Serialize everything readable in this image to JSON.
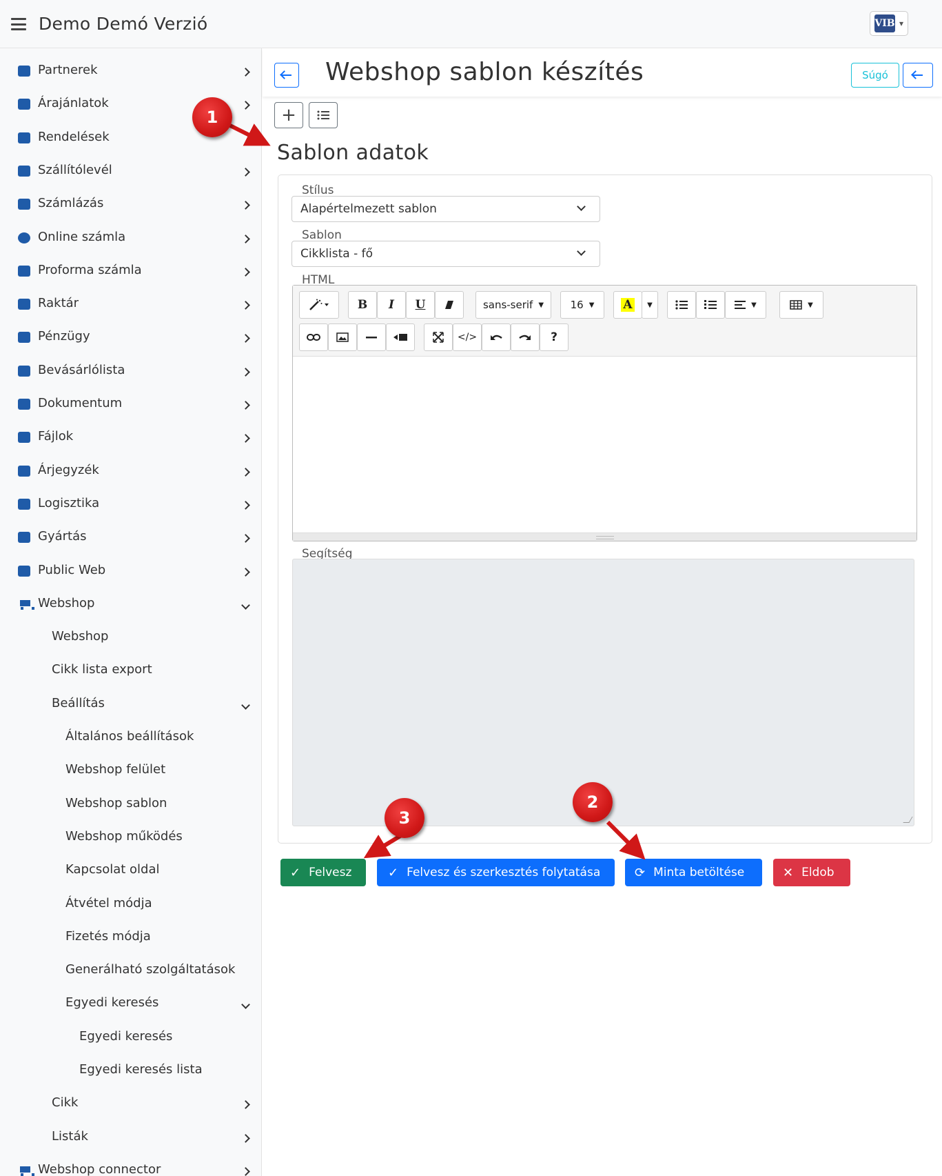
{
  "app": {
    "title": "Demo Demó Verzió",
    "logo_text": "VIB",
    "logo_caret": "▾"
  },
  "sidebar": {
    "items": [
      {
        "label": "Partnerek",
        "icon": "address-card-icon",
        "level": 0,
        "chevron": "right"
      },
      {
        "label": "Árajánlatok",
        "icon": "chat-bubbles-icon",
        "level": 0,
        "chevron": "right"
      },
      {
        "label": "Rendelések",
        "icon": "file-icon",
        "level": 0,
        "chevron": ""
      },
      {
        "label": "Szállítólevél",
        "icon": "clipboard-icon",
        "level": 0,
        "chevron": "right"
      },
      {
        "label": "Számlázás",
        "icon": "invoice-icon",
        "level": 0,
        "chevron": "right"
      },
      {
        "label": "Online számla",
        "icon": "globe-icon",
        "level": 0,
        "chevron": "right"
      },
      {
        "label": "Proforma számla",
        "icon": "note-icon",
        "level": 0,
        "chevron": "right"
      },
      {
        "label": "Raktár",
        "icon": "warehouse-icon",
        "level": 0,
        "chevron": "right"
      },
      {
        "label": "Pénzügy",
        "icon": "money-icon",
        "level": 0,
        "chevron": "right"
      },
      {
        "label": "Bevásárlólista",
        "icon": "list-icon",
        "level": 0,
        "chevron": "right"
      },
      {
        "label": "Dokumentum",
        "icon": "document-icon",
        "level": 0,
        "chevron": "right"
      },
      {
        "label": "Fájlok",
        "icon": "files-icon",
        "level": 0,
        "chevron": "right"
      },
      {
        "label": "Árjegyzék",
        "icon": "tags-icon",
        "level": 0,
        "chevron": "right"
      },
      {
        "label": "Logisztika",
        "icon": "dolly-icon",
        "level": 0,
        "chevron": "right"
      },
      {
        "label": "Gyártás",
        "icon": "cubes-icon",
        "level": 0,
        "chevron": "right"
      },
      {
        "label": "Public Web",
        "icon": "web-icon",
        "level": 0,
        "chevron": "right"
      },
      {
        "label": "Webshop",
        "icon": "cart-icon",
        "level": 0,
        "chevron": "down"
      },
      {
        "label": "Webshop",
        "icon": "",
        "level": 1,
        "chevron": ""
      },
      {
        "label": "Cikk lista export",
        "icon": "",
        "level": 1,
        "chevron": ""
      },
      {
        "label": "Beállítás",
        "icon": "",
        "level": 1,
        "chevron": "down"
      },
      {
        "label": "Általános beállítások",
        "icon": "",
        "level": 2,
        "chevron": ""
      },
      {
        "label": "Webshop felület",
        "icon": "",
        "level": 2,
        "chevron": ""
      },
      {
        "label": "Webshop sablon",
        "icon": "",
        "level": 2,
        "chevron": ""
      },
      {
        "label": "Webshop működés",
        "icon": "",
        "level": 2,
        "chevron": ""
      },
      {
        "label": "Kapcsolat oldal",
        "icon": "",
        "level": 2,
        "chevron": ""
      },
      {
        "label": "Átvétel módja",
        "icon": "",
        "level": 2,
        "chevron": ""
      },
      {
        "label": "Fizetés módja",
        "icon": "",
        "level": 2,
        "chevron": ""
      },
      {
        "label": "Generálható szolgáltatások",
        "icon": "",
        "level": 2,
        "chevron": ""
      },
      {
        "label": "Egyedi keresés",
        "icon": "",
        "level": 2,
        "chevron": "down"
      },
      {
        "label": "Egyedi keresés",
        "icon": "",
        "level": 3,
        "chevron": ""
      },
      {
        "label": "Egyedi keresés lista",
        "icon": "",
        "level": 3,
        "chevron": ""
      },
      {
        "label": "Cikk",
        "icon": "",
        "level": 1,
        "chevron": "right"
      },
      {
        "label": "Listák",
        "icon": "",
        "level": 1,
        "chevron": "right"
      },
      {
        "label": "Webshop connector",
        "icon": "cart-icon",
        "level": 0,
        "chevron": "right"
      }
    ]
  },
  "header": {
    "title": "Webshop sablon készítés",
    "help_label": "Súgó"
  },
  "form": {
    "section_title": "Sablon adatok",
    "style_legend": "Stílus",
    "style_value": "Alapértelmezett sablon",
    "template_legend": "Sablon",
    "template_value": "Cikklista - fő",
    "html_legend": "HTML",
    "help_legend": "Segítség",
    "editor": {
      "font_family": "sans-serif",
      "font_size": "16",
      "bold": "B",
      "italic": "I",
      "underline": "U",
      "highlight": "A",
      "help": "?"
    }
  },
  "actions": {
    "save": "Felvesz",
    "save_continue": "Felvesz és szerkesztés folytatása",
    "load_sample": "Minta betöltése",
    "discard": "Eldob"
  },
  "annotations": [
    "1",
    "2",
    "3"
  ],
  "colors": {
    "primary": "#0d6efd",
    "success": "#198754",
    "danger": "#dc3545",
    "info": "#17c1d8",
    "marker": "#d01818",
    "sidebar_icon": "#1f5ba8"
  }
}
